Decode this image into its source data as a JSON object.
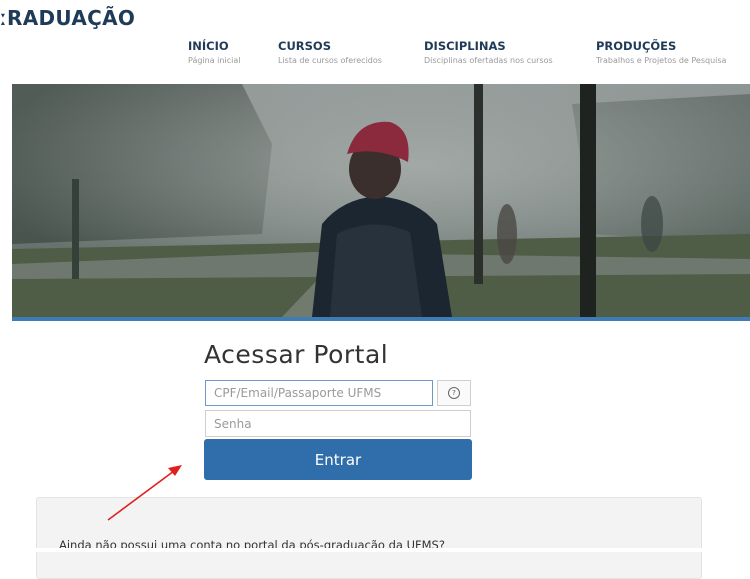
{
  "header": {
    "brand": "ːRADUAÇÃO"
  },
  "nav": [
    {
      "title": "INÍCIO",
      "subtitle": "Página inicial"
    },
    {
      "title": "CURSOS",
      "subtitle": "Lista de cursos oferecidos"
    },
    {
      "title": "DISCIPLINAS",
      "subtitle": "Disciplinas ofertadas nos cursos"
    },
    {
      "title": "PRODUÇÕES",
      "subtitle": "Trabalhos e Projetos de Pesquisa"
    }
  ],
  "login": {
    "title": "Acessar Portal",
    "username_placeholder": "CPF/Email/Passaporte UFMS",
    "password_placeholder": "Senha",
    "submit_label": "Entrar",
    "help_symbol": "?"
  },
  "info": {
    "text": "Ainda não possui uma conta no portal da pós-graduação da UFMS?"
  },
  "colors": {
    "brand": "#1f3b57",
    "accent": "#2f6eaa",
    "annotation_arrow": "#e02020"
  },
  "icons": {
    "help": "help-icon",
    "arrow": "annotation-arrow"
  }
}
